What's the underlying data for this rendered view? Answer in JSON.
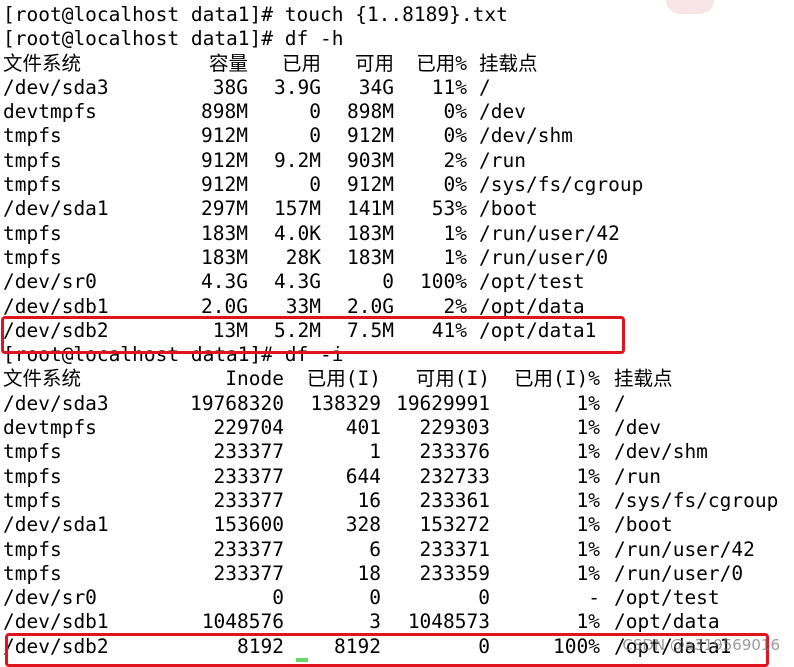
{
  "top_command": {
    "prompt": "[root@localhost data1]# ",
    "command": "touch {1..8189}.txt"
  },
  "df_h": {
    "prompt": "[root@localhost data1]# ",
    "command": "df -h",
    "headers": [
      "文件系统",
      "容量",
      "已用",
      "可用",
      "已用%",
      "挂载点"
    ],
    "rows": [
      [
        "/dev/sda3",
        "38G",
        "3.9G",
        "34G",
        "11%",
        "/"
      ],
      [
        "devtmpfs",
        "898M",
        "0",
        "898M",
        "0%",
        "/dev"
      ],
      [
        "tmpfs",
        "912M",
        "0",
        "912M",
        "0%",
        "/dev/shm"
      ],
      [
        "tmpfs",
        "912M",
        "9.2M",
        "903M",
        "2%",
        "/run"
      ],
      [
        "tmpfs",
        "912M",
        "0",
        "912M",
        "0%",
        "/sys/fs/cgroup"
      ],
      [
        "/dev/sda1",
        "297M",
        "157M",
        "141M",
        "53%",
        "/boot"
      ],
      [
        "tmpfs",
        "183M",
        "4.0K",
        "183M",
        "1%",
        "/run/user/42"
      ],
      [
        "tmpfs",
        "183M",
        "28K",
        "183M",
        "1%",
        "/run/user/0"
      ],
      [
        "/dev/sr0",
        "4.3G",
        "4.3G",
        "0",
        "100%",
        "/opt/test"
      ],
      [
        "/dev/sdb1",
        "2.0G",
        "33M",
        "2.0G",
        "2%",
        "/opt/data"
      ],
      [
        "/dev/sdb2",
        "13M",
        "5.2M",
        "7.5M",
        "41%",
        "/opt/data1"
      ]
    ]
  },
  "df_i": {
    "prompt": "[root@localhost data1]# ",
    "command": "df -i",
    "headers": [
      "文件系统",
      "Inode",
      "已用(I)",
      "可用(I)",
      "已用(I)%",
      "挂载点"
    ],
    "rows": [
      [
        "/dev/sda3",
        "19768320",
        "138329",
        "19629991",
        "1%",
        "/"
      ],
      [
        "devtmpfs",
        "229704",
        "401",
        "229303",
        "1%",
        "/dev"
      ],
      [
        "tmpfs",
        "233377",
        "1",
        "233376",
        "1%",
        "/dev/shm"
      ],
      [
        "tmpfs",
        "233377",
        "644",
        "232733",
        "1%",
        "/run"
      ],
      [
        "tmpfs",
        "233377",
        "16",
        "233361",
        "1%",
        "/sys/fs/cgroup"
      ],
      [
        "/dev/sda1",
        "153600",
        "328",
        "153272",
        "1%",
        "/boot"
      ],
      [
        "tmpfs",
        "233377",
        "6",
        "233371",
        "1%",
        "/run/user/42"
      ],
      [
        "tmpfs",
        "233377",
        "18",
        "233359",
        "1%",
        "/run/user/0"
      ],
      [
        "/dev/sr0",
        "0",
        "0",
        "0",
        "-",
        "/opt/test"
      ],
      [
        "/dev/sdb1",
        "1048576",
        "3",
        "1048573",
        "1%",
        "/opt/data"
      ],
      [
        "/dev/sdb2",
        "8192",
        "8192",
        "0",
        "100%",
        "/opt/data1"
      ]
    ]
  },
  "watermark": "CSDN @a319569016",
  "colors": {
    "highlight": "#e0141e",
    "text": "#000000",
    "background": "#ffffff"
  }
}
